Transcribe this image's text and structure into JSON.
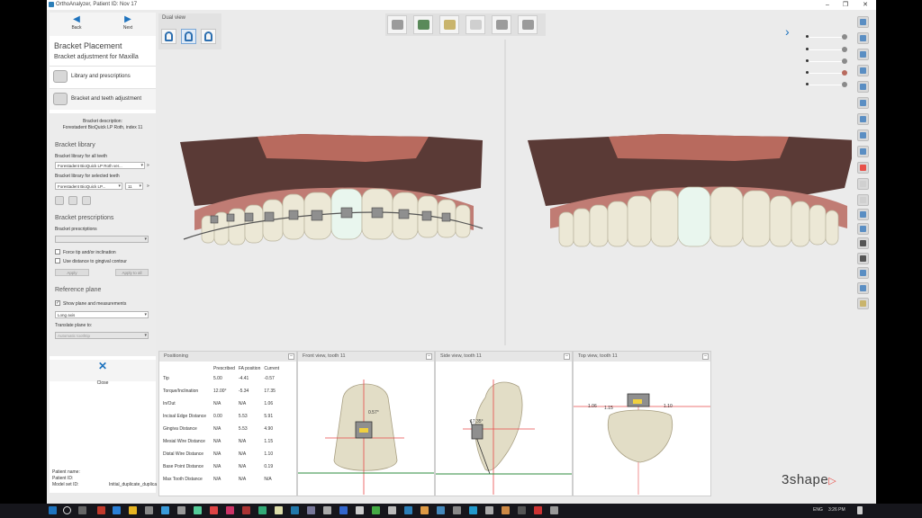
{
  "window": {
    "title": "OrthoAnalyzer, Patient ID: Nov 17"
  },
  "nav": {
    "back": "Back",
    "next": "Next"
  },
  "panel": {
    "title": "Bracket Placement",
    "subtitle": "Bracket adjustment for Maxilla",
    "steps": [
      {
        "label": "Library and prescriptions"
      },
      {
        "label": "Bracket and teeth adjustment"
      }
    ],
    "bracket_description_label": "Bracket description:",
    "bracket_description_value": "Forestadent BioQuick LP Roth, index 11",
    "library_heading": "Bracket library",
    "library_all_label": "Bracket library for all teeth",
    "library_all_value": "Forestadent BioQuick LP Roth ver...",
    "library_selected_label": "Bracket library for selected teeth",
    "library_selected_value": "Forestadent BioQuick LP...",
    "tooth_index": "11",
    "prescriptions_heading": "Bracket prescriptions",
    "prescriptions_label": "Bracket prescriptions",
    "force_tip": "Force tip and/or inclination",
    "use_distance": "Use distance to gingival contour",
    "apply": "Apply",
    "apply_to_all": "Apply to all",
    "reference_heading": "Reference plane",
    "show_plane": "Show plane and measurements",
    "plane_type": "Long axis",
    "translate_label": "Translate plane to:",
    "translate_value": "Automatic toothtip",
    "close": "Close",
    "patient_name_label": "Patient name:",
    "patient_id_label": "Patient ID:",
    "model_set_label": "Model set ID:",
    "patient_id_value": "",
    "model_set_value": "Initial_duplicate_duplica"
  },
  "dual_view": {
    "label": "Dual view"
  },
  "positioning": {
    "title": "Positioning",
    "columns": [
      "",
      "Prescribed",
      "FA position",
      "Current"
    ],
    "rows": [
      [
        "Tip",
        "5.00",
        "-4.41",
        "-0.57"
      ],
      [
        "Torque/Inclination",
        "12.00°",
        "-5.34",
        "17.35"
      ],
      [
        "In/Out",
        "N/A",
        "N/A",
        "1.06"
      ],
      [
        "Incisal Edge Distance",
        "0.00",
        "5.53",
        "5.91"
      ],
      [
        "Gingiva Distance",
        "N/A",
        "5.53",
        "4.90"
      ],
      [
        "Mesial Wire Distance",
        "N/A",
        "N/A",
        "1.15"
      ],
      [
        "Distal Wire Distance",
        "N/A",
        "N/A",
        "1.10"
      ],
      [
        "Base Point Distance",
        "N/A",
        "N/A",
        "0.19"
      ],
      [
        "Max Tooth Distance",
        "N/A",
        "N/A",
        "N/A"
      ]
    ]
  },
  "views": {
    "front": {
      "title": "Front view, tooth 11",
      "angle": "0.57°"
    },
    "side": {
      "title": "Side view, tooth 11",
      "angle": "17.35°"
    },
    "top": {
      "title": "Top view, tooth 11",
      "left": "1.06",
      "mid": "1.15",
      "right": "1.10"
    }
  },
  "brand": {
    "name": "3shape"
  },
  "taskbar": {
    "lang": "ENG",
    "time": "3:26 PM"
  },
  "colors": {
    "accent": "#1e73be",
    "brand": "#e8514a",
    "gum": "#b86a5e",
    "base": "#5a3a36",
    "tooth": "#ece8d6"
  }
}
